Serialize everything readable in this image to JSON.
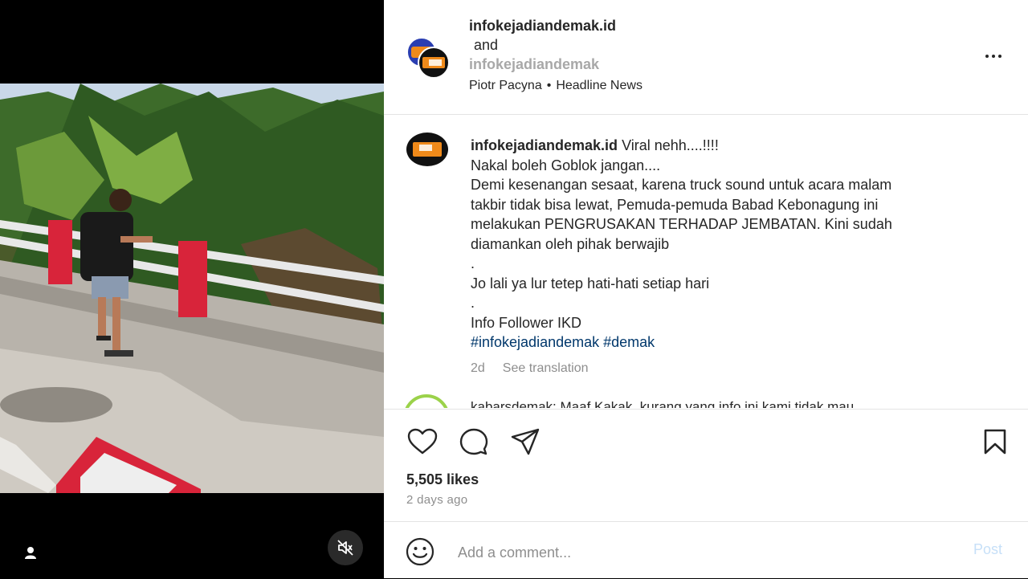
{
  "post": {
    "author_primary": "infokejadiandemak.id",
    "and_text": "and",
    "author_secondary": "infokejadiandemak",
    "music_artist": "Piotr Pacyna",
    "music_separator": "•",
    "music_track": "Headline News"
  },
  "caption": {
    "username": "infokejadiandemak.id",
    "line1": "Viral nehh....!!!!",
    "line2": "Nakal boleh Goblok jangan....",
    "line3": "Demi kesenangan sesaat, karena truck sound untuk acara malam",
    "line4": "takbir tidak bisa lewat, Pemuda-pemuda Babad Kebonagung ini",
    "line5": "melakukan PENGRUSAKAN TERHADAP JEMBATAN. Kini sudah",
    "line6": "diamankan oleh pihak berwajib",
    "dot1": ".",
    "line7": "Jo lali ya lur tetep hati-hati setiap hari",
    "dot2": ".",
    "line8": "Info Follower IKD",
    "hashtag1": "#infokejadiandemak",
    "hashtag2": "#demak",
    "age": "2d",
    "see_translation": "See translation"
  },
  "next_comment": {
    "text": "kabarsdemak: Maaf Kakak, kurang yang info ini kami tidak mau"
  },
  "actions": {
    "like_icon": "heart-icon",
    "comment_icon": "comment-icon",
    "share_icon": "send-icon",
    "save_icon": "bookmark-icon"
  },
  "likes": "5,505 likes",
  "time_ago": "2 days ago",
  "comment_box": {
    "placeholder": "Add a comment...",
    "post_label": "Post"
  },
  "colors": {
    "link": "#00376b",
    "post_disabled": "#c7e0f8",
    "muted": "#8e8e8e"
  }
}
